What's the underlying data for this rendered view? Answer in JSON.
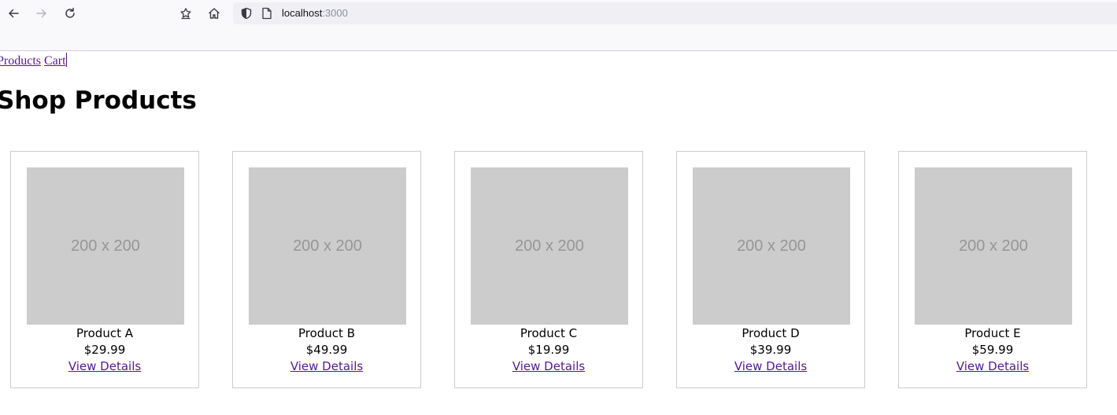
{
  "browser": {
    "url_host": "localhost",
    "url_port": ":3000",
    "icons": [
      "back-arrow-icon",
      "forward-arrow-icon",
      "reload-icon",
      "bookmark-star-icon",
      "home-icon",
      "shield-icon",
      "page-icon"
    ]
  },
  "nav": {
    "products_label": "Products",
    "cart_label": "Cart"
  },
  "page": {
    "title": "Shop Products"
  },
  "products": [
    {
      "image_label": "200 x 200",
      "name": "Product A",
      "price": "$29.99",
      "link_label": "View Details"
    },
    {
      "image_label": "200 x 200",
      "name": "Product B",
      "price": "$49.99",
      "link_label": "View Details"
    },
    {
      "image_label": "200 x 200",
      "name": "Product C",
      "price": "$19.99",
      "link_label": "View Details"
    },
    {
      "image_label": "200 x 200",
      "name": "Product D",
      "price": "$39.99",
      "link_label": "View Details"
    },
    {
      "image_label": "200 x 200",
      "name": "Product E",
      "price": "$59.99",
      "link_label": "View Details"
    }
  ],
  "colors": {
    "link": "#551a8b",
    "placeholder_bg": "#cccccc",
    "placeholder_text": "#969696",
    "card_border": "#cccccc"
  }
}
